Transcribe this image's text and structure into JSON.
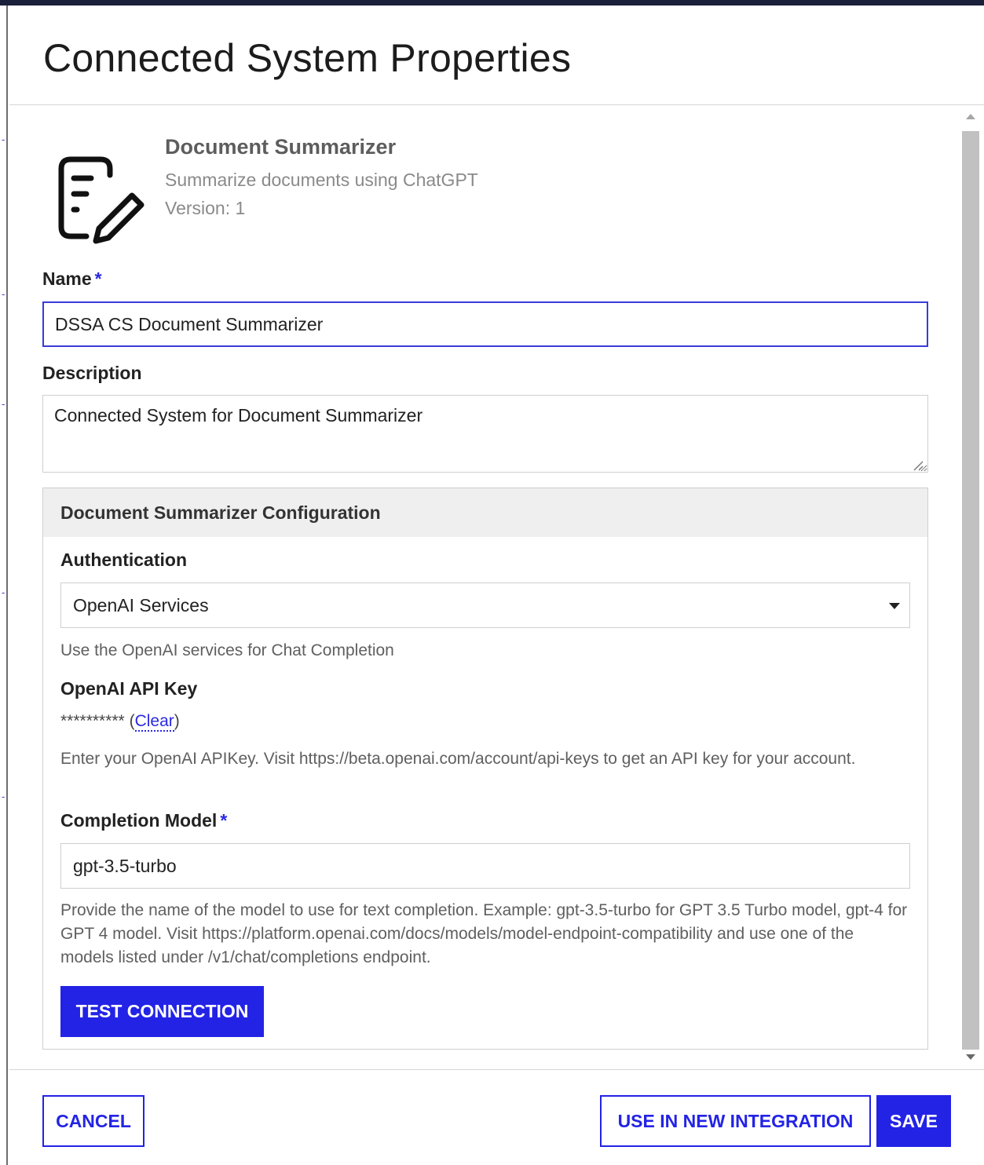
{
  "dialog": {
    "title": "Connected System Properties"
  },
  "plugin": {
    "icon": "document-edit-icon",
    "name": "Document Summarizer",
    "description": "Summarize documents using ChatGPT",
    "version": "Version: 1"
  },
  "form": {
    "name_label": "Name",
    "name_value": "DSSA CS Document Summarizer",
    "required_marker": "*",
    "description_label": "Description",
    "description_value": "Connected System for Document Summarizer"
  },
  "config": {
    "title": "Document Summarizer Configuration",
    "authentication_label": "Authentication",
    "authentication_value": "OpenAI Services",
    "authentication_help": "Use the OpenAI services for Chat Completion",
    "api_key_label": "OpenAI API Key",
    "api_key_masked": "**********",
    "api_key_clear_label": "Clear",
    "api_key_help": "Enter your OpenAI APIKey. Visit https://beta.openai.com/account/api-keys to get an API key for your account.",
    "model_label": "Completion Model",
    "model_value": "gpt-3.5-turbo",
    "model_help": "Provide the name of the model to use for text completion. Example: gpt-3.5-turbo for GPT 3.5 Turbo model, gpt-4 for GPT 4 model. Visit https://platform.openai.com/docs/models/model-endpoint-compatibility and use one of the models listed under /v1/chat/completions endpoint.",
    "test_button_label": "TEST CONNECTION"
  },
  "footer": {
    "cancel_label": "CANCEL",
    "use_in_integration_label": "USE IN NEW INTEGRATION",
    "save_label": "SAVE"
  },
  "colors": {
    "accent": "#2323e6",
    "required": "#2a2ae0"
  }
}
